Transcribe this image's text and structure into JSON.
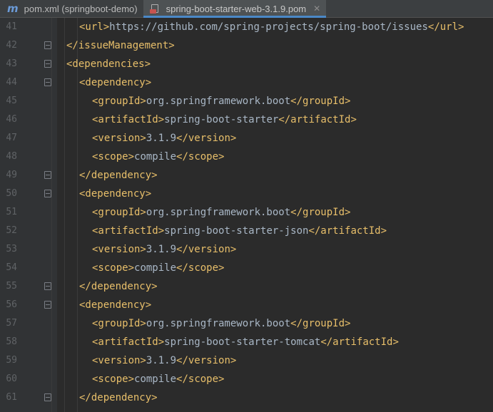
{
  "tabs": [
    {
      "icon": "maven-icon",
      "label": "pom.xml (springboot-demo)",
      "active": false
    },
    {
      "icon": "pom-file-icon",
      "label": "spring-boot-starter-web-3.1.9.pom",
      "active": true
    }
  ],
  "code_lines": [
    {
      "num": "41",
      "indent": 1,
      "fold": "",
      "parts": [
        [
          "tag",
          "<url>"
        ],
        [
          "txt",
          "https://github.com/spring-projects/spring-boot/issues"
        ],
        [
          "tag",
          "</url>"
        ]
      ]
    },
    {
      "num": "42",
      "indent": 0,
      "fold": "close",
      "parts": [
        [
          "tag",
          "</issueManagement>"
        ]
      ]
    },
    {
      "num": "43",
      "indent": 0,
      "fold": "open",
      "parts": [
        [
          "tag",
          "<dependencies>"
        ]
      ]
    },
    {
      "num": "44",
      "indent": 1,
      "fold": "open",
      "parts": [
        [
          "tag",
          "<dependency>"
        ]
      ]
    },
    {
      "num": "45",
      "indent": 2,
      "fold": "",
      "parts": [
        [
          "tag",
          "<groupId>"
        ],
        [
          "txt",
          "org.springframework.boot"
        ],
        [
          "tag",
          "</groupId>"
        ]
      ]
    },
    {
      "num": "46",
      "indent": 2,
      "fold": "",
      "parts": [
        [
          "tag",
          "<artifactId>"
        ],
        [
          "txt",
          "spring-boot-starter"
        ],
        [
          "tag",
          "</artifactId>"
        ]
      ]
    },
    {
      "num": "47",
      "indent": 2,
      "fold": "",
      "parts": [
        [
          "tag",
          "<version>"
        ],
        [
          "txt",
          "3.1.9"
        ],
        [
          "tag",
          "</version>"
        ]
      ]
    },
    {
      "num": "48",
      "indent": 2,
      "fold": "",
      "parts": [
        [
          "tag",
          "<scope>"
        ],
        [
          "txt",
          "compile"
        ],
        [
          "tag",
          "</scope>"
        ]
      ]
    },
    {
      "num": "49",
      "indent": 1,
      "fold": "close",
      "parts": [
        [
          "tag",
          "</dependency>"
        ]
      ]
    },
    {
      "num": "50",
      "indent": 1,
      "fold": "open",
      "parts": [
        [
          "tag",
          "<dependency>"
        ]
      ]
    },
    {
      "num": "51",
      "indent": 2,
      "fold": "",
      "parts": [
        [
          "tag",
          "<groupId>"
        ],
        [
          "txt",
          "org.springframework.boot"
        ],
        [
          "tag",
          "</groupId>"
        ]
      ]
    },
    {
      "num": "52",
      "indent": 2,
      "fold": "",
      "parts": [
        [
          "tag",
          "<artifactId>"
        ],
        [
          "txt",
          "spring-boot-starter-json"
        ],
        [
          "tag",
          "</artifactId>"
        ]
      ]
    },
    {
      "num": "53",
      "indent": 2,
      "fold": "",
      "parts": [
        [
          "tag",
          "<version>"
        ],
        [
          "txt",
          "3.1.9"
        ],
        [
          "tag",
          "</version>"
        ]
      ]
    },
    {
      "num": "54",
      "indent": 2,
      "fold": "",
      "parts": [
        [
          "tag",
          "<scope>"
        ],
        [
          "txt",
          "compile"
        ],
        [
          "tag",
          "</scope>"
        ]
      ]
    },
    {
      "num": "55",
      "indent": 1,
      "fold": "close",
      "parts": [
        [
          "tag",
          "</dependency>"
        ]
      ]
    },
    {
      "num": "56",
      "indent": 1,
      "fold": "open",
      "parts": [
        [
          "tag",
          "<dependency>"
        ]
      ]
    },
    {
      "num": "57",
      "indent": 2,
      "fold": "",
      "parts": [
        [
          "tag",
          "<groupId>"
        ],
        [
          "txt",
          "org.springframework.boot"
        ],
        [
          "tag",
          "</groupId>"
        ]
      ]
    },
    {
      "num": "58",
      "indent": 2,
      "fold": "",
      "parts": [
        [
          "tag",
          "<artifactId>"
        ],
        [
          "txt",
          "spring-boot-starter-tomcat"
        ],
        [
          "tag",
          "</artifactId>"
        ]
      ]
    },
    {
      "num": "59",
      "indent": 2,
      "fold": "",
      "parts": [
        [
          "tag",
          "<version>"
        ],
        [
          "txt",
          "3.1.9"
        ],
        [
          "tag",
          "</version>"
        ]
      ]
    },
    {
      "num": "60",
      "indent": 2,
      "fold": "",
      "parts": [
        [
          "tag",
          "<scope>"
        ],
        [
          "txt",
          "compile"
        ],
        [
          "tag",
          "</scope>"
        ]
      ]
    },
    {
      "num": "61",
      "indent": 1,
      "fold": "close",
      "parts": [
        [
          "tag",
          "</dependency>"
        ]
      ]
    }
  ],
  "colors": {
    "editor_bg": "#2b2b2b",
    "gutter_bg": "#313335",
    "tag": "#e8bf6a",
    "text": "#a9b7c6",
    "line_number": "#606366",
    "active_tab_underline": "#4a88c7"
  }
}
